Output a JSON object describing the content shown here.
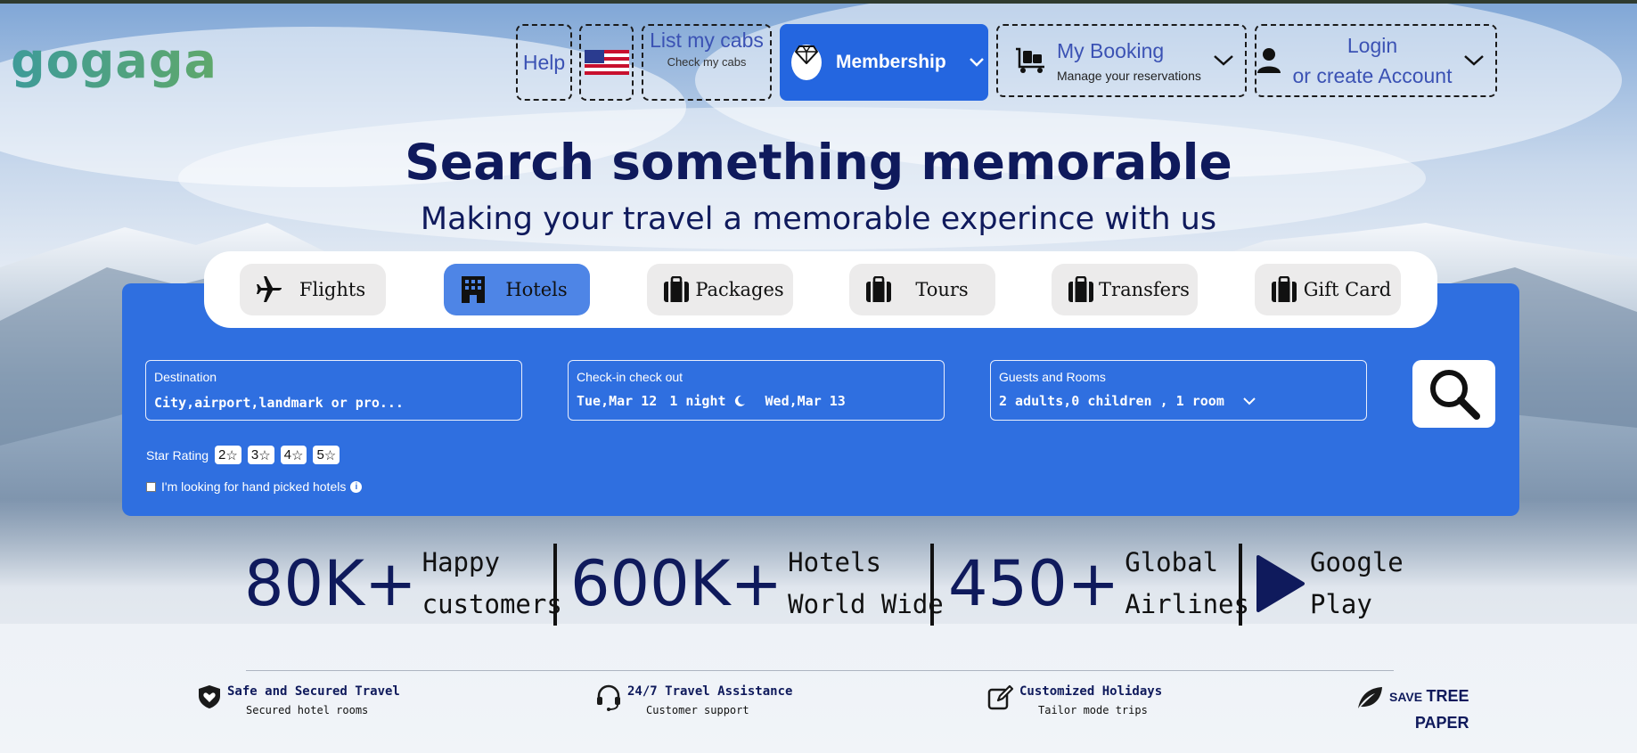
{
  "brand": {
    "logo": "gogaga"
  },
  "nav": {
    "help": "Help",
    "cabs_title": "List my cabs",
    "cabs_sub": "Check my cabs",
    "membership": "Membership",
    "booking_title": "My Booking",
    "booking_sub": "Manage your reservations",
    "login_line1": "Login",
    "login_line2": "or create Account"
  },
  "hero": {
    "title": "Search something memorable",
    "subtitle": "Making your travel a memorable experince with us"
  },
  "tabs": [
    {
      "label": "Flights",
      "icon": "plane-icon",
      "active": false
    },
    {
      "label": "Hotels",
      "icon": "hotel-icon",
      "active": true
    },
    {
      "label": "Packages",
      "icon": "suitcase-icon",
      "active": false
    },
    {
      "label": "Tours",
      "icon": "suitcase-icon",
      "active": false
    },
    {
      "label": "Transfers",
      "icon": "suitcase-icon",
      "active": false
    },
    {
      "label": "Gift Card",
      "icon": "suitcase-icon",
      "active": false
    }
  ],
  "search": {
    "destination_label": "Destination",
    "destination_placeholder": "City,airport,landmark or pro...",
    "dates_label": "Check-in check out",
    "checkin": "Tue,Mar 12",
    "nights": "1 night",
    "checkout": "Wed,Mar 13",
    "guests_label": "Guests and Rooms",
    "guests_value": "2 adults,0 children , 1 room",
    "star_label": "Star Rating",
    "stars": [
      "2",
      "3",
      "4",
      "5"
    ],
    "handpicked_label": "I'm looking for hand picked hotels",
    "handpicked_checked": false
  },
  "stats": [
    {
      "number": "80K+",
      "label_line1": "Happy",
      "label_line2": "customers"
    },
    {
      "number": "600K+",
      "label_line1": "Hotels",
      "label_line2": "World Wide"
    },
    {
      "number": "450+",
      "label_line1": "Global",
      "label_line2": "Airlines"
    },
    {
      "number": "",
      "label_line1": "Google",
      "label_line2": "Play"
    }
  ],
  "features": [
    {
      "title": "Safe and Secured Travel",
      "sub": "Secured hotel rooms",
      "icon": "shield-heart-icon"
    },
    {
      "title": "24/7 Travel Assistance",
      "sub": "Customer support",
      "icon": "headset-icon"
    },
    {
      "title": "Customized Holidays",
      "sub": "Tailor mode trips",
      "icon": "edit-icon"
    }
  ],
  "save_tree": {
    "small": "SAVE",
    "line1": "TREE",
    "line2": "PAPER"
  },
  "colors": {
    "primary": "#2f6fe0",
    "navy": "#0f1a5c",
    "nav_text": "#3b52b4"
  }
}
